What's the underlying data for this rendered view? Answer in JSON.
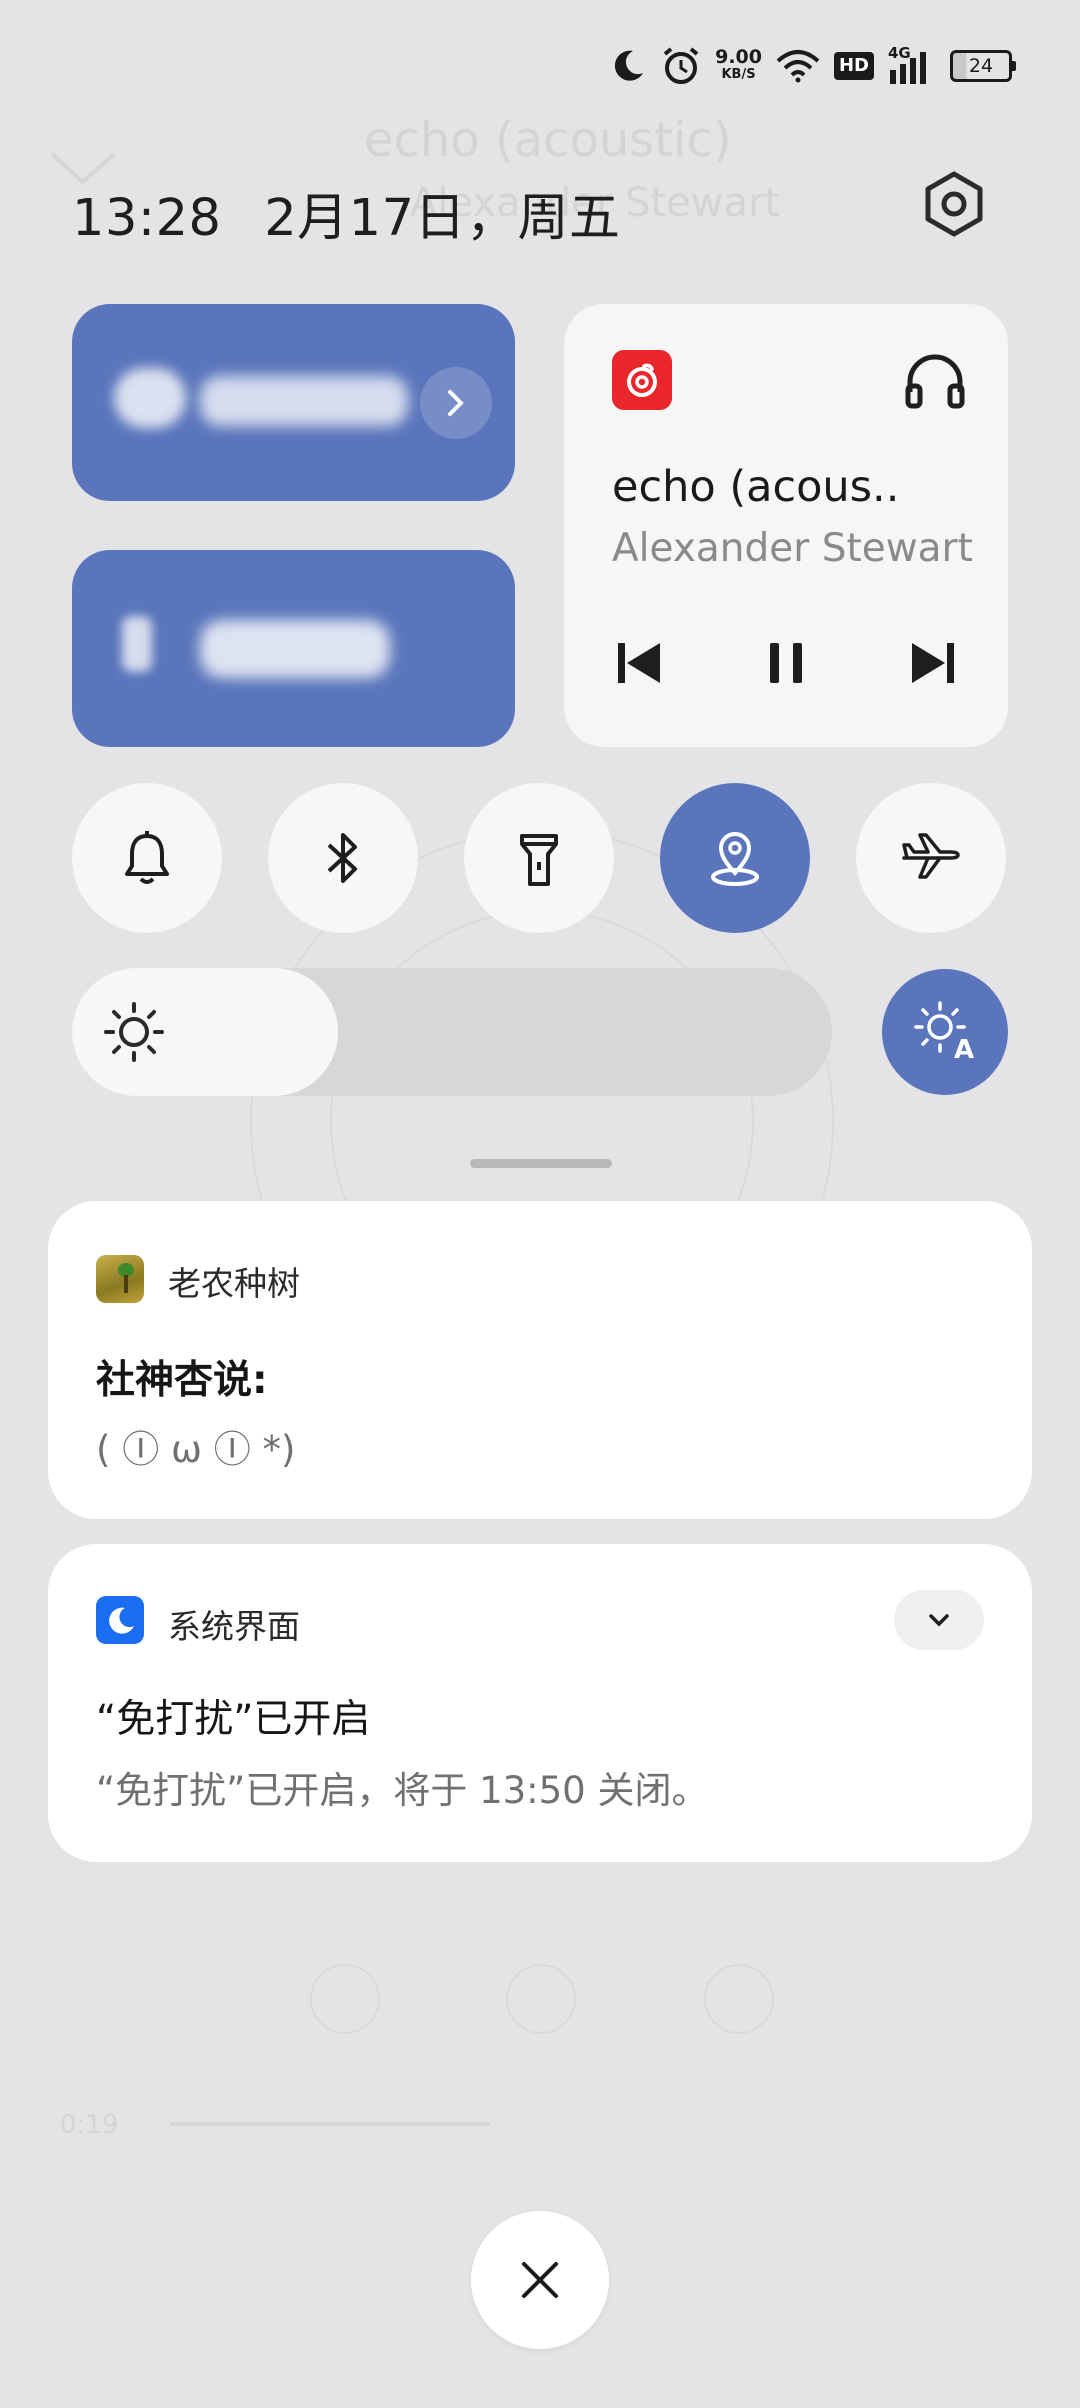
{
  "background_app": {
    "title": "echo (acoustic)",
    "artist": "Alexander Stewart",
    "time": "0:19"
  },
  "status_bar": {
    "net_speed_value": "9.00",
    "net_speed_unit": "KB/S",
    "hd_label": "HD",
    "network_label": "4G",
    "battery": "24",
    "icons": [
      "moon-icon",
      "alarm-icon",
      "wifi-icon",
      "hd-icon",
      "signal-icon",
      "battery-icon"
    ]
  },
  "header": {
    "time": "13:28",
    "date": "2月17日，周五"
  },
  "media": {
    "app_icon": "netease-music-icon",
    "title": "echo (acous..",
    "artist": "Alexander Stewart",
    "output_icon": "headphones-icon"
  },
  "quick_toggles": [
    {
      "name": "ring",
      "icon": "bell-icon",
      "active": false
    },
    {
      "name": "bluetooth",
      "icon": "bluetooth-icon",
      "active": false
    },
    {
      "name": "flashlight",
      "icon": "flashlight-icon",
      "active": false
    },
    {
      "name": "location",
      "icon": "location-icon",
      "active": true
    },
    {
      "name": "airplane",
      "icon": "airplane-icon",
      "active": false
    }
  ],
  "brightness": {
    "level": 0.35,
    "auto_label": "A"
  },
  "notifications": [
    {
      "app": "老农种树",
      "title": "社神杏说:",
      "body": "( Ⓘ ω Ⓘ *)"
    },
    {
      "app": "系统界面",
      "title": "“免打扰”已开启",
      "body": "“免打扰”已开启，将于 13:50 关闭。"
    }
  ],
  "colors": {
    "accent": "#5a75bb",
    "background": "#e4e4e6",
    "card": "#ffffff",
    "media_app": "#e8262c",
    "notif_sys_icon": "#1a6cf0"
  }
}
